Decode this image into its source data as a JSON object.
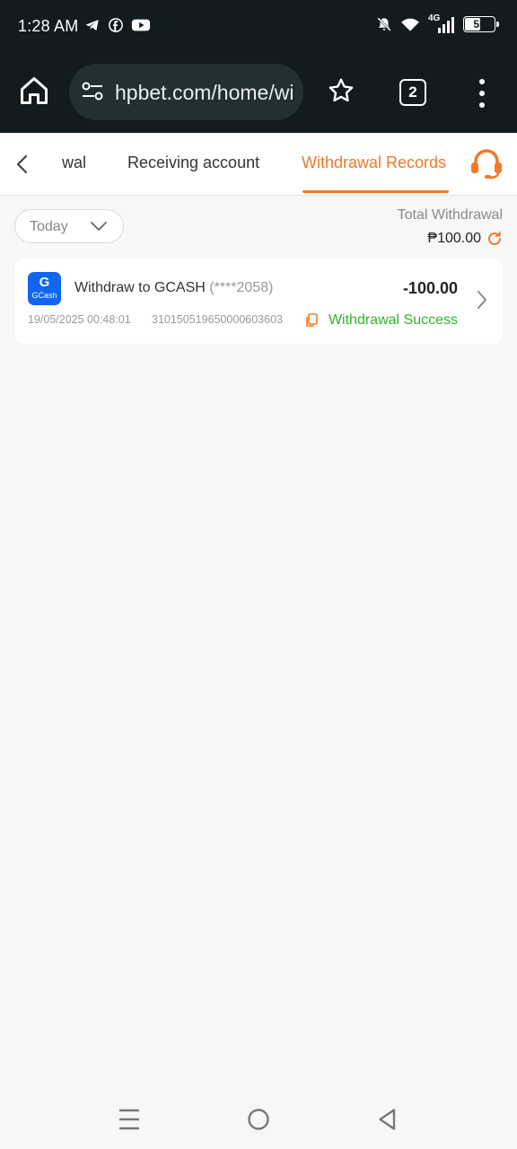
{
  "status_bar": {
    "time": "1:28 AM",
    "app_icons": [
      "telegram-icon",
      "facebook-icon",
      "youtube-icon"
    ],
    "right_icons": [
      "mute-icon",
      "wifi-icon",
      "signal-4g-icon"
    ],
    "network": "4G",
    "battery": "55",
    "battery_level": 0.55
  },
  "browser": {
    "url": "hpbet.com/home/wi",
    "tab_count": "2"
  },
  "header": {
    "tabs": [
      {
        "label": "wal",
        "active": false
      },
      {
        "label": "Receiving account",
        "active": false
      },
      {
        "label": "Withdrawal Records",
        "active": true
      }
    ],
    "accent_color": "#f07a28"
  },
  "filter": {
    "selected": "Today"
  },
  "summary": {
    "label": "Total Withdrawal",
    "value": "₱100.00"
  },
  "records": [
    {
      "logo_letter": "G",
      "logo_text": "GCash",
      "title": "Withdraw to GCASH",
      "account": "(****2058)",
      "amount": "-100.00",
      "datetime": "19/05/2025 00:48:01",
      "tx_id": "310150519650000603603",
      "status": "Withdrawal Success",
      "status_color": "#2eb52e"
    }
  ]
}
